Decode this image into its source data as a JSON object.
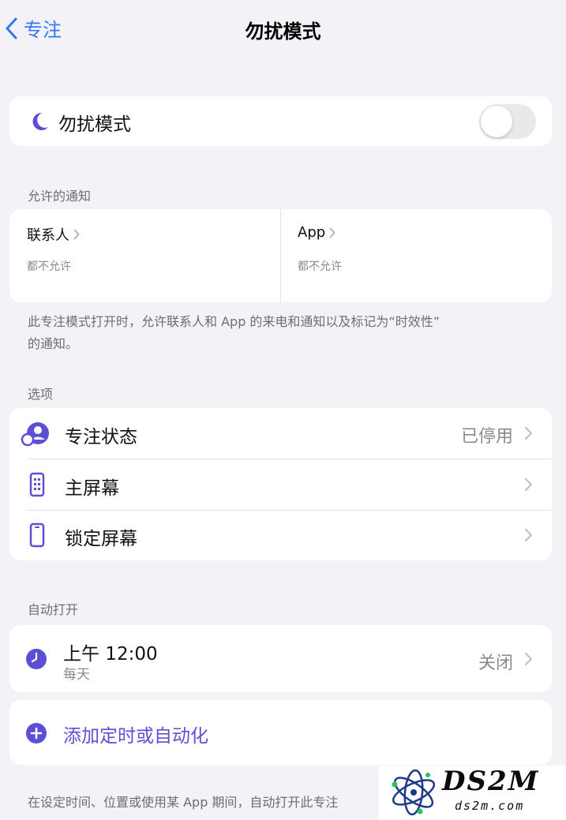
{
  "nav": {
    "back_label": "专注",
    "title": "勿扰模式"
  },
  "dnd_row": {
    "label": "勿扰模式",
    "toggle_on": false
  },
  "allowed": {
    "header": "允许的通知",
    "contacts": {
      "title": "联系人",
      "subtitle": "都不允许"
    },
    "apps": {
      "title": "App",
      "subtitle": "都不允许"
    },
    "footer_line1": "此专注模式打开时，允许联系人和 App 的来电和通知以及标记为“时效性”",
    "footer_line2": "的通知。"
  },
  "options": {
    "header": "选项",
    "items": [
      {
        "label": "专注状态",
        "value": "已停用",
        "icon": "focus-status-icon"
      },
      {
        "label": "主屏幕",
        "value": "",
        "icon": "home-screen-icon"
      },
      {
        "label": "锁定屏幕",
        "value": "",
        "icon": "lock-screen-icon"
      }
    ]
  },
  "auto": {
    "header": "自动打开",
    "schedule": {
      "time": "上午 12:00",
      "repeat": "每天",
      "value": "关闭",
      "icon": "clock-icon"
    },
    "add_label": "添加定时或自动化",
    "footer": "在设定时间、位置或使用某 App 期间，自动打开此专注"
  },
  "watermark": {
    "big": "DS2M",
    "small": "ds2m.com"
  },
  "colors": {
    "accent_blue": "#3478f6",
    "purple": "#5b4fd6",
    "background": "#f2f2f7"
  }
}
